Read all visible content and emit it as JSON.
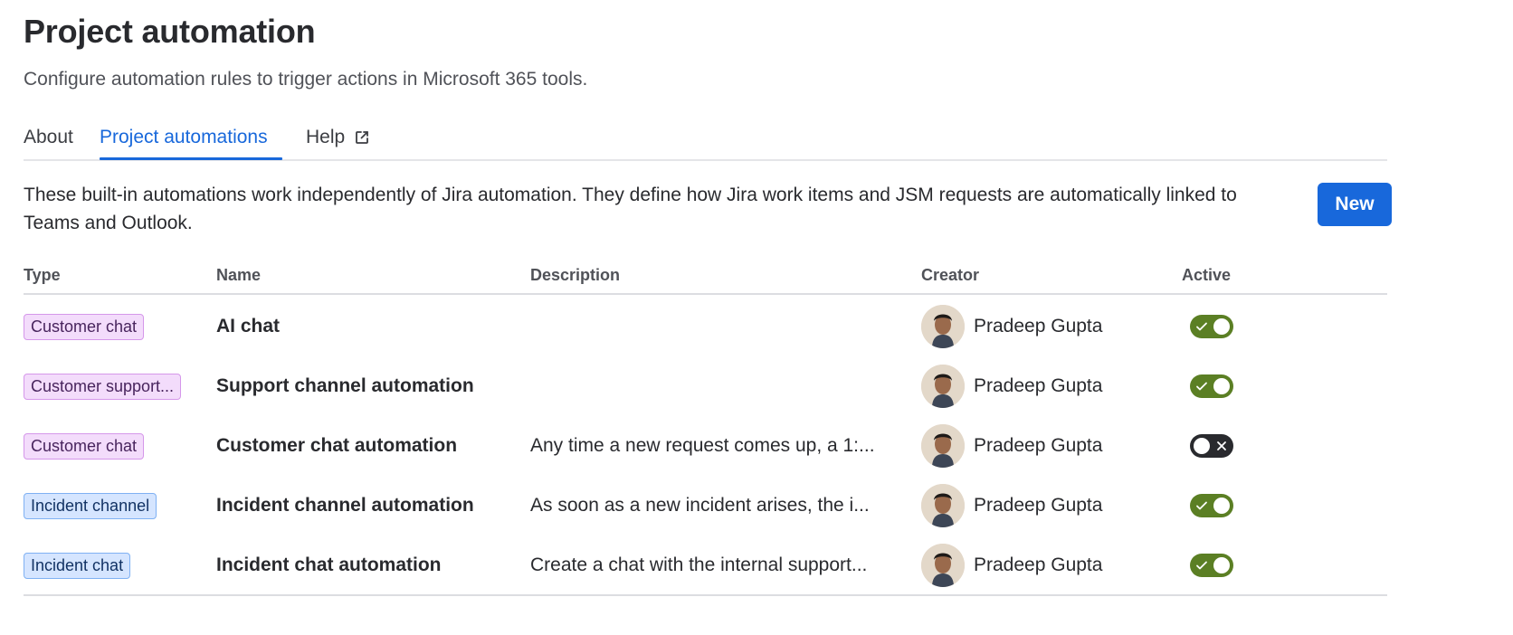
{
  "header": {
    "title": "Project automation",
    "subtitle": "Configure automation rules to trigger actions in Microsoft 365 tools."
  },
  "tabs": [
    {
      "label": "About",
      "active": false
    },
    {
      "label": "Project automations",
      "active": true
    },
    {
      "label": "Help",
      "active": false,
      "icon": "external-link-icon"
    }
  ],
  "intro": {
    "text": "These built-in automations work independently of Jira automation. They define how Jira work items and JSM requests are automatically linked to Teams and Outlook."
  },
  "toolbar": {
    "new_label": "New"
  },
  "table": {
    "headers": {
      "type": "Type",
      "name": "Name",
      "description": "Description",
      "creator": "Creator",
      "active": "Active"
    },
    "rows": [
      {
        "type": "Customer chat",
        "type_color": "purple",
        "name": "AI chat",
        "description": "",
        "creator": "Pradeep Gupta",
        "active": true
      },
      {
        "type": "Customer support...",
        "type_color": "purple",
        "name": "Support channel automation",
        "description": "",
        "creator": "Pradeep Gupta",
        "active": true
      },
      {
        "type": "Customer chat",
        "type_color": "purple",
        "name": "Customer chat automation",
        "description": "Any time a new request comes up, a 1:...",
        "creator": "Pradeep Gupta",
        "active": false
      },
      {
        "type": "Incident channel",
        "type_color": "blue",
        "name": "Incident channel automation",
        "description": "As soon as a new incident arises, the i...",
        "creator": "Pradeep Gupta",
        "active": true
      },
      {
        "type": "Incident chat",
        "type_color": "blue",
        "name": "Incident chat automation",
        "description": "Create a chat with the internal support...",
        "creator": "Pradeep Gupta",
        "active": true
      }
    ]
  },
  "colors": {
    "brand": "#1868db",
    "toggle_on": "#5b7f24",
    "toggle_off": "#292a2e",
    "lozenge_purple": "#f3dcfb",
    "lozenge_blue": "#d5e5ff"
  }
}
